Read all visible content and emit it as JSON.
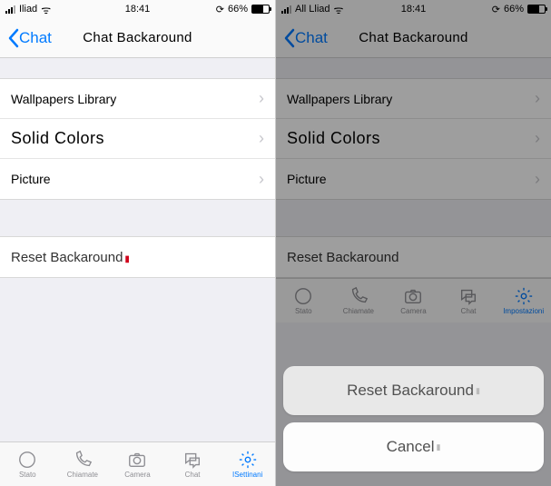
{
  "left": {
    "status": {
      "carrier": "Iliad",
      "time": "18:41",
      "pct": "66%",
      "orient": "⟳"
    },
    "nav": {
      "back": "Chat",
      "title": "Chat Backaround"
    },
    "rows": {
      "wallpapers": "Wallpapers Library",
      "solid": "Solid Colors",
      "picture": "Picture",
      "reset": "Reset Backaround"
    },
    "tabs": {
      "stato": "Stato",
      "chiamate": "Chiamate",
      "camera": "Camera",
      "chat": "Chat",
      "settings": "ISettinani"
    }
  },
  "right": {
    "status": {
      "carrier": "All Lliad",
      "time": "18:41",
      "pct": "66%",
      "orient": "⟳"
    },
    "nav": {
      "back": "Chat",
      "title": "Chat Backaround"
    },
    "rows": {
      "wallpapers": "Wallpapers Library",
      "solid": "Solid Colors",
      "picture": "Picture",
      "reset": "Reset Backaround"
    },
    "sheet": {
      "reset": "Reset Backaround",
      "cancel": "Cancel"
    },
    "tabs": {
      "stato": "Stato",
      "chiamate": "Chiamate",
      "camera": "Camera",
      "chat": "Chat",
      "settings": "Impostazioni"
    }
  }
}
